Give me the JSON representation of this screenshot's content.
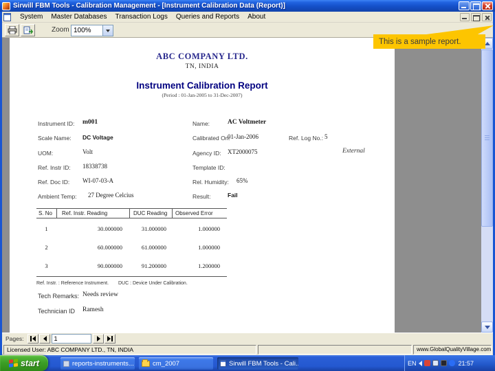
{
  "window": {
    "title": "Sirwill FBM Tools - Calibration Management - [Instrument Calibration Data (Report)]",
    "menu_items": [
      "System",
      "Master Databases",
      "Transaction Logs",
      "Queries and Reports",
      "About"
    ]
  },
  "toolbar": {
    "zoom_label": "Zoom",
    "zoom_value": "100%"
  },
  "callout": {
    "text": "This is a sample report."
  },
  "report": {
    "company": "ABC COMPANY LTD.",
    "location": "TN, INDIA",
    "title": "Instrument Calibration Report",
    "period": "(Period : 01-Jan-2005 to 31-Dec-2007)",
    "fields_left": [
      {
        "label": "Instrument ID:",
        "value": "m001"
      },
      {
        "label": "Scale Name:",
        "value": "DC Voltage"
      },
      {
        "label": "UOM:",
        "value": "Volt"
      },
      {
        "label": "Ref. Instr ID:",
        "value": "18338738"
      },
      {
        "label": "Ref. Doc ID:",
        "value": "WI-07-03-A"
      },
      {
        "label": "Ambient Temp:",
        "value": "27 Degree Celcius"
      }
    ],
    "fields_right": [
      {
        "label": "Name:",
        "value": "AC Voltmeter"
      },
      {
        "label": "Calibrated On:",
        "value": "01-Jan-2006"
      },
      {
        "label": "Agency ID:",
        "value": "XT2000075"
      },
      {
        "label": "Template ID:",
        "value": ""
      },
      {
        "label": "Rel. Humidity:",
        "value": "65%"
      },
      {
        "label": "Result:",
        "value": "Fail"
      }
    ],
    "ref_log": {
      "label": "Ref. Log No.:",
      "value": "5"
    },
    "external_tag": "External",
    "table": {
      "headers": [
        "S. No",
        "Ref. Instr. Reading",
        "DUC Reading",
        "Observed Error"
      ],
      "rows": [
        [
          "1",
          "30.000000",
          "31.000000",
          "1.000000"
        ],
        [
          "2",
          "60.000000",
          "61.000000",
          "1.000000"
        ],
        [
          "3",
          "90.000000",
          "91.200000",
          "1.200000"
        ]
      ]
    },
    "footnote_left": "Ref. Instr. : Reference Instrument.",
    "footnote_right": "DUC : Device Under Calibration.",
    "tech_remarks_label": "Tech Remarks:",
    "tech_remarks_value": "Needs review",
    "technician_label": "Technician ID",
    "technician_value": "Ramesh"
  },
  "pager": {
    "label": "Pages:",
    "value": "1"
  },
  "statusbar": {
    "left": "Licensed User: ABC COMPANY LTD., TN, INDIA",
    "right": "www.GlobalQualityVillage.com"
  },
  "taskbar": {
    "start": "start",
    "buttons": [
      "reports-instruments...",
      "cm_2007",
      "Sirwill FBM Tools - Cali..."
    ],
    "tray_lang": "EN",
    "tray_time": "21:57"
  },
  "colors": {
    "titlebar_blue": "#1450c8",
    "report_navy": "#000080",
    "callout_gold": "#fdc500",
    "taskbar_blue": "#2458d0",
    "start_green": "#3d9f27"
  }
}
